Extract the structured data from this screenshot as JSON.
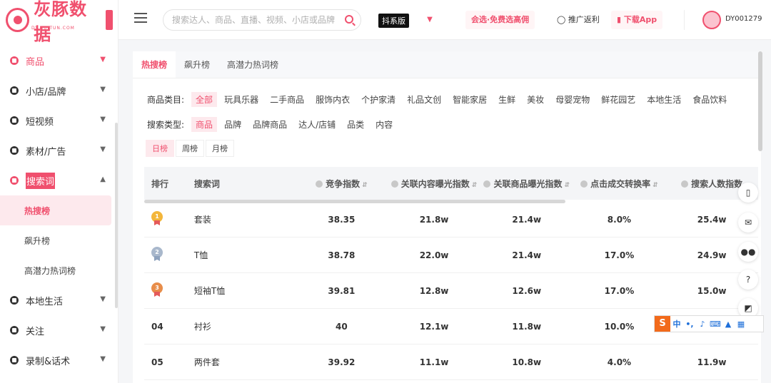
{
  "brand": {
    "name": "灰豚数据",
    "sub": "DY.HUITUN.COM"
  },
  "sidebar": {
    "items": [
      {
        "label": "商品",
        "active": true,
        "icon": "product-icon"
      },
      {
        "label": "小店/品牌",
        "icon": "store-icon"
      },
      {
        "label": "短视频",
        "icon": "video-icon"
      },
      {
        "label": "素材/广告",
        "icon": "material-icon"
      },
      {
        "label": "搜索词",
        "active": true,
        "expanded": true,
        "icon": "search-word-icon"
      },
      {
        "label": "本地生活",
        "icon": "local-life-icon"
      },
      {
        "label": "关注",
        "icon": "follow-icon"
      },
      {
        "label": "录制&话术",
        "icon": "record-icon"
      }
    ],
    "subitems": [
      {
        "label": "热搜榜",
        "active": true
      },
      {
        "label": "飙升榜"
      },
      {
        "label": "高潜力热词榜"
      }
    ]
  },
  "header": {
    "search_placeholder": "搜索达人、商品、直播、视频、小店或品牌",
    "version": "抖系版",
    "promo": "会选·免费选高佣",
    "rebate": "推广返利",
    "download": "下载App",
    "username": "DY001279"
  },
  "tabs": [
    "热搜榜",
    "飙升榜",
    "高潜力热词榜"
  ],
  "filters": {
    "category_label": "商品类目:",
    "categories": [
      "全部",
      "玩具乐器",
      "二手商品",
      "服饰内衣",
      "个护家清",
      "礼品文创",
      "智能家居",
      "生鲜",
      "美妆",
      "母婴宠物",
      "鲜花园艺",
      "本地生活",
      "食品饮料"
    ],
    "search_type_label": "搜索类型:",
    "search_types": [
      "商品",
      "品牌",
      "品牌商品",
      "达人/店铺",
      "品类",
      "内容"
    ],
    "periods": [
      "日榜",
      "周榜",
      "月榜"
    ]
  },
  "table": {
    "headers": [
      "排行",
      "搜索词",
      "竞争指数",
      "关联内容曝光指数",
      "关联商品曝光指数",
      "点击成交转换率",
      "搜索人数指数"
    ],
    "rows": [
      {
        "rank": "1",
        "word": "套装",
        "competition": "38.35",
        "content_exposure": "21.8w",
        "product_exposure": "21.4w",
        "conversion": "8.0%",
        "searchers": "25.4w"
      },
      {
        "rank": "2",
        "word": "T恤",
        "competition": "38.78",
        "content_exposure": "22.0w",
        "product_exposure": "21.4w",
        "conversion": "17.0%",
        "searchers": "24.9w"
      },
      {
        "rank": "3",
        "word": "短袖T恤",
        "competition": "39.81",
        "content_exposure": "12.8w",
        "product_exposure": "12.6w",
        "conversion": "17.0%",
        "searchers": "15.0w"
      },
      {
        "rank": "04",
        "word": "衬衫",
        "competition": "40",
        "content_exposure": "12.1w",
        "product_exposure": "11.8w",
        "conversion": "10.0%",
        "searchers": ""
      },
      {
        "rank": "05",
        "word": "两件套",
        "competition": "39.92",
        "content_exposure": "11.1w",
        "product_exposure": "10.8w",
        "conversion": "4.0%",
        "searchers": "11.9w"
      }
    ]
  },
  "float_tools": [
    "phone-icon",
    "mail-icon",
    "wechat-icon",
    "help-icon",
    "headset-icon"
  ],
  "ime": {
    "logo": "S",
    "mode": "中",
    "punct": "•,"
  },
  "colors": {
    "accent": "#f0506e"
  }
}
